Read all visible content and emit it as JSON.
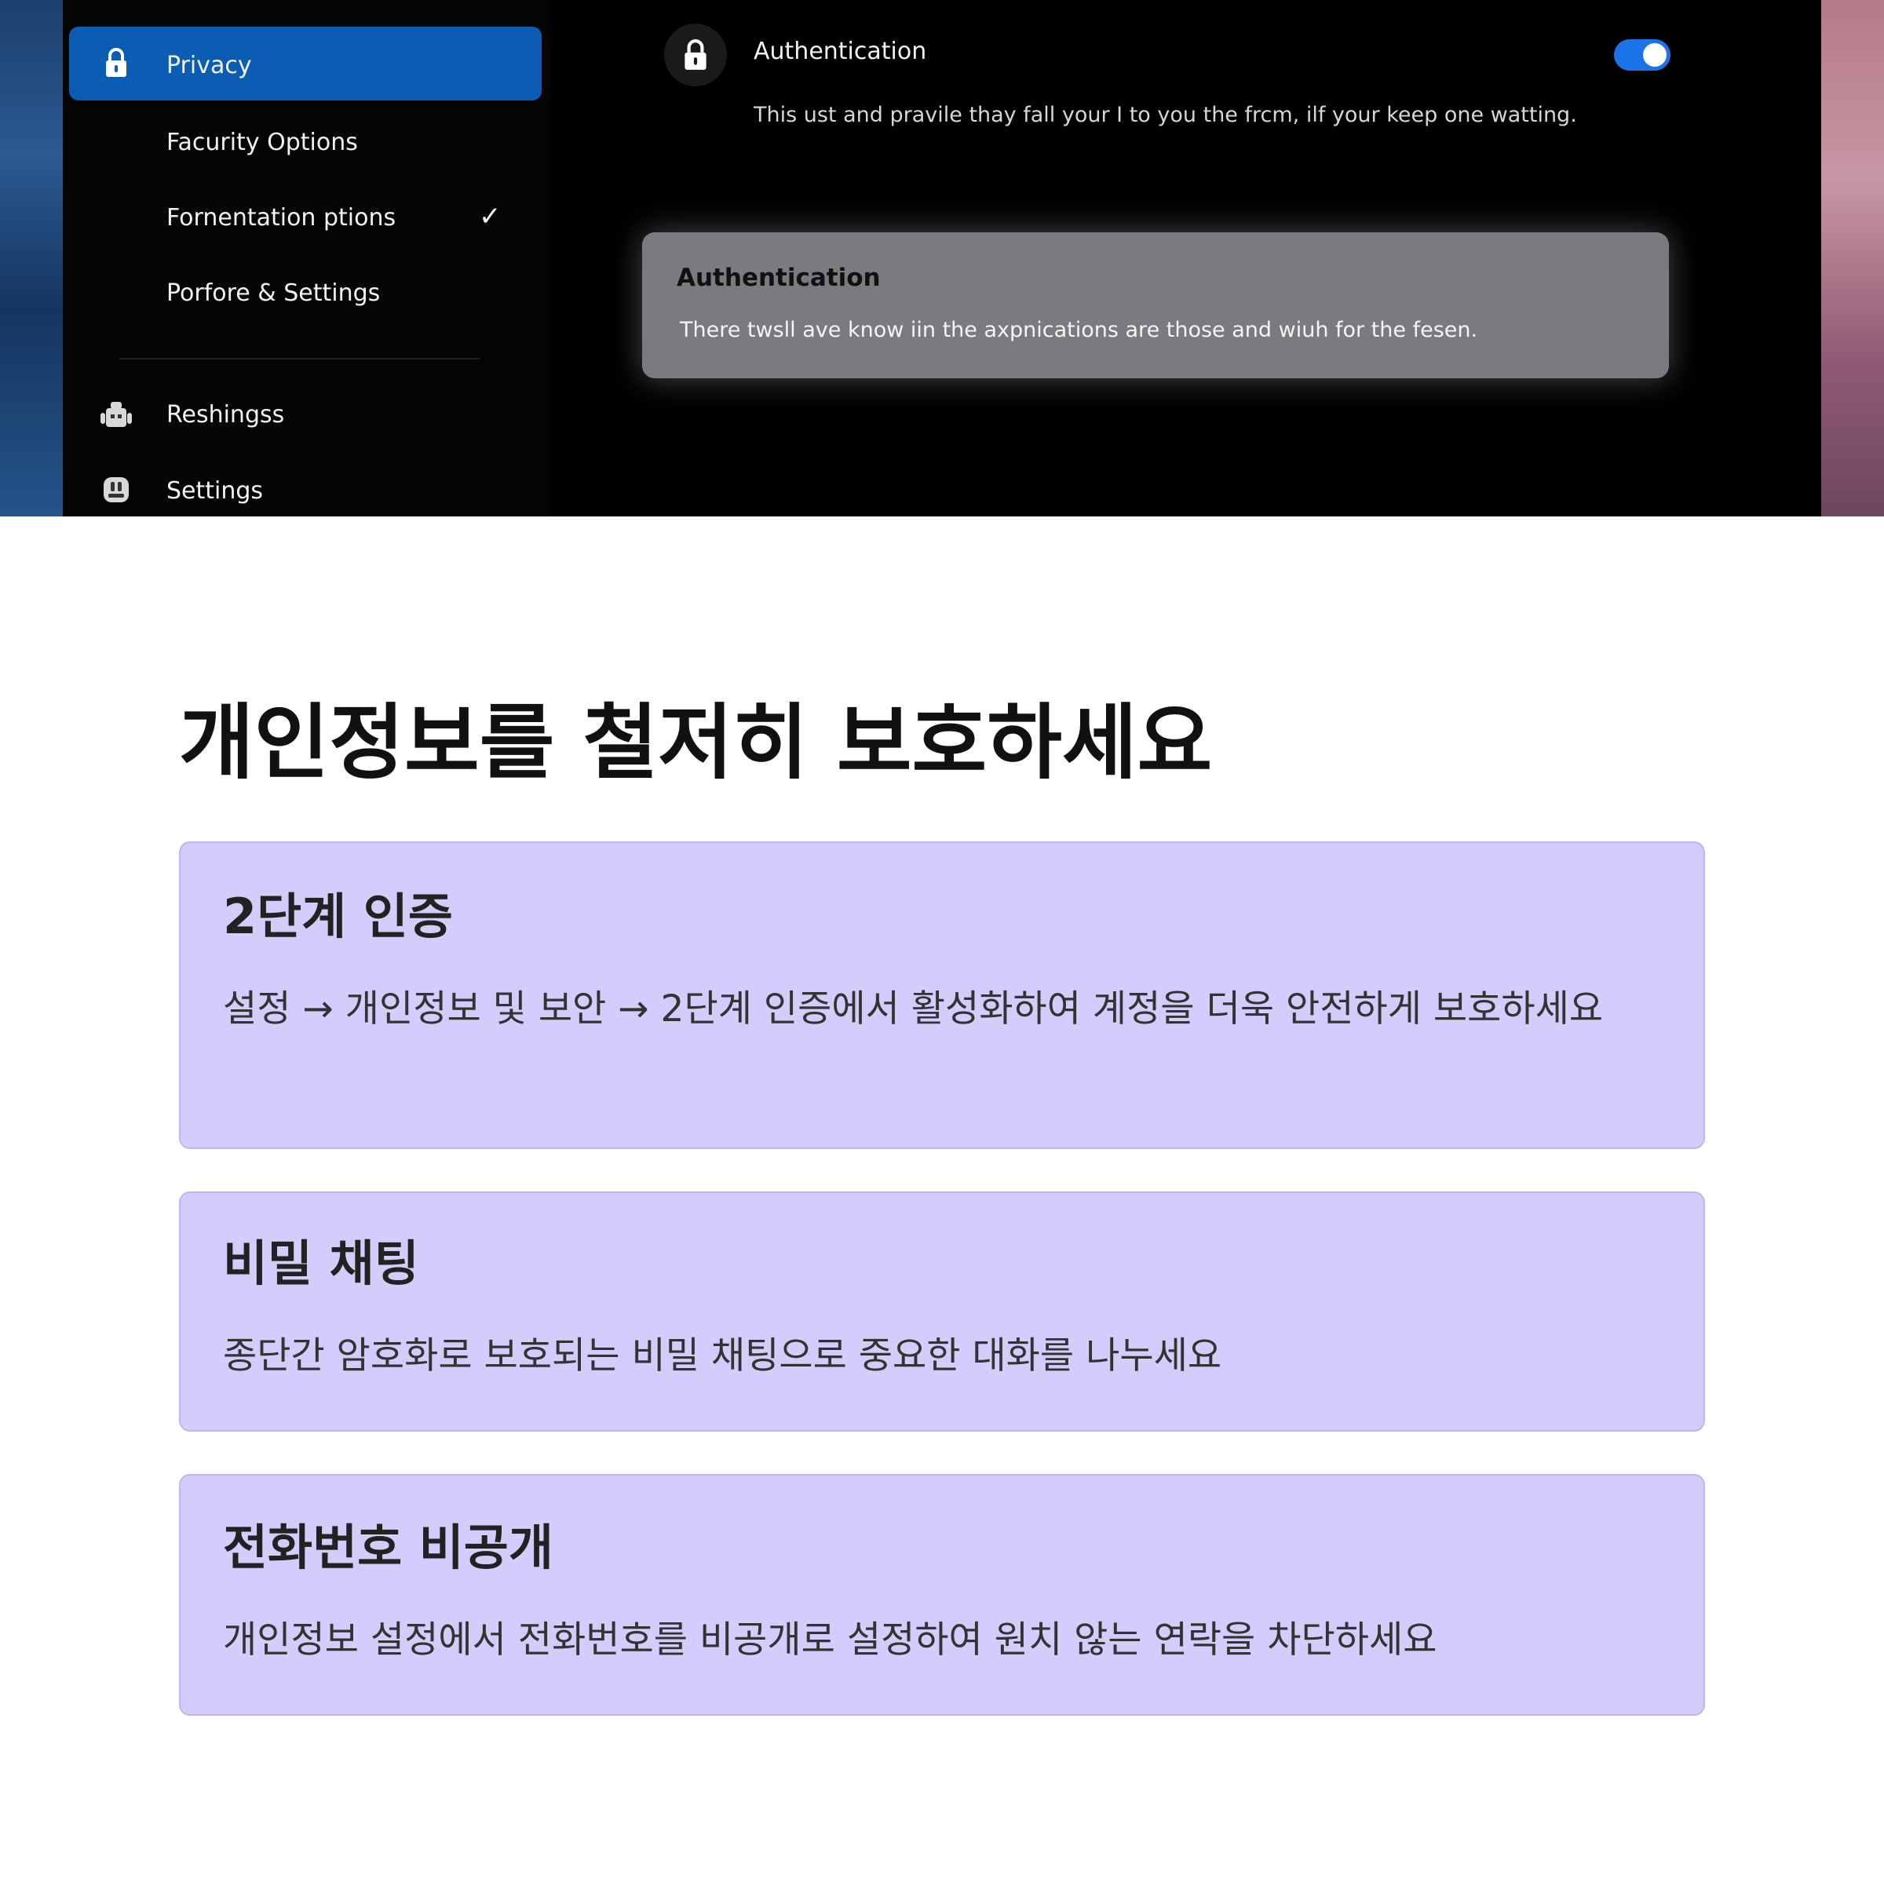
{
  "sidebar": {
    "items": [
      {
        "label": "Privacy",
        "icon": "lock-icon",
        "active": true
      },
      {
        "label": "Facurity Options"
      },
      {
        "label": "Fornentation ptions",
        "checked": true
      },
      {
        "label": "Porfore & Settings"
      },
      {
        "label": "Reshingss",
        "icon": "robot-icon"
      },
      {
        "label": "Settings",
        "icon": "settings-icon"
      }
    ],
    "check_glyph": "✓"
  },
  "settings": {
    "title": "Authentication",
    "description": "This ust and pravile thay fall your I to you the frcm, ilf your keep one watting.",
    "toggle_on": true,
    "accent": "#1a74e8"
  },
  "popup": {
    "title": "Authentication",
    "text": "There twsll ave know iin the axpnications are those and wiuh for the fesen."
  },
  "article": {
    "title": "개인정보를 철저히 보호하세요",
    "cards": [
      {
        "title": "2단계 인증",
        "text": "설정 → 개인정보 및 보안 → 2단계 인증에서 활성화하여 계정을 더욱 안전하게 보호하세요"
      },
      {
        "title": "비밀 채팅",
        "text": "종단간 암호화로 보호되는 비밀 채팅으로 중요한 대화를 나누세요"
      },
      {
        "title": "전화번호 비공개",
        "text": "개인정보 설정에서 전화번호를 비공개로 설정하여 원치 않는 연락을 차단하세요"
      }
    ],
    "card_color": "#d2cdfb"
  }
}
